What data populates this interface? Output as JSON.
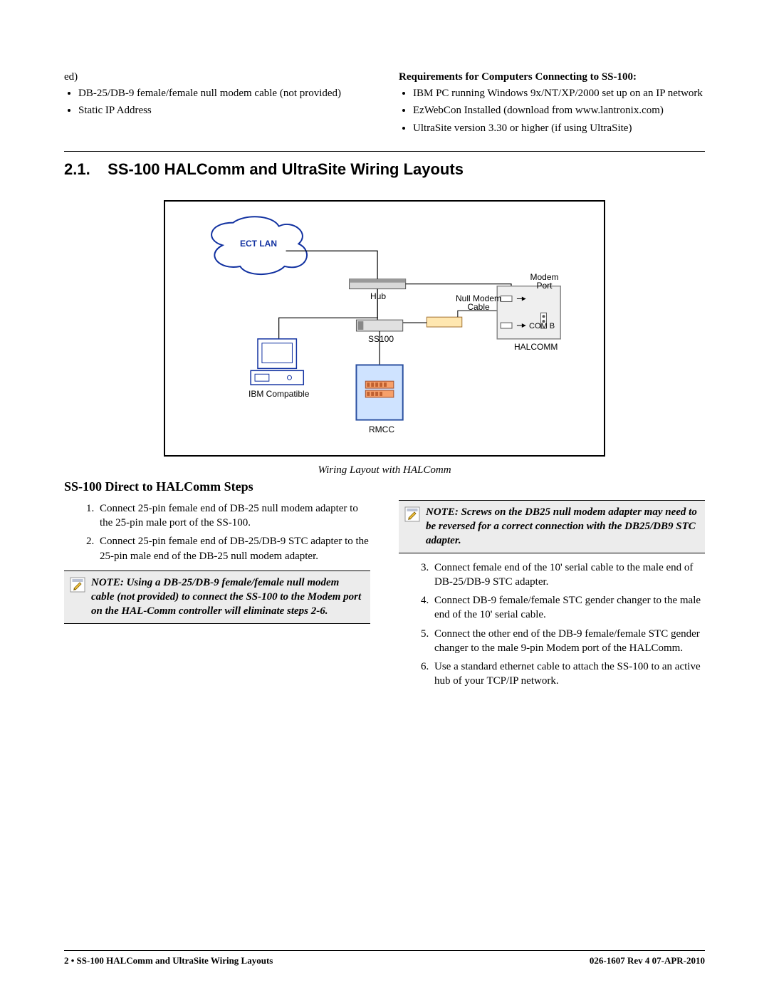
{
  "top": {
    "left_fragment": "ed)",
    "left_bullets": [
      "DB-25/DB-9 female/female null modem cable (not provided)",
      "Static IP Address"
    ],
    "right_heading": "Requirements for Computers Connecting to SS-100:",
    "right_bullets": [
      "IBM PC running Windows 9x/NT/XP/2000 set up on an IP network",
      " EzWebCon Installed (download from www.lantronix.com)",
      "UltraSite version 3.30 or higher (if using UltraSite)"
    ]
  },
  "section": {
    "number": "2.1.",
    "title": "SS-100 HALComm and UltraSite Wiring Layouts"
  },
  "figure": {
    "caption": "Wiring Layout with HALComm",
    "labels": {
      "ectlan": "ECT LAN",
      "hub": "Hub",
      "modem_port": "Modem Port",
      "null_modem": "Null Modem Cable",
      "ss100": "SS100",
      "comb": "COM B",
      "halcomm": "HALCOMM",
      "ibm": "IBM Compatible",
      "rmcc": "RMCC"
    }
  },
  "subsection": {
    "title": "SS-100 Direct to HALComm Steps"
  },
  "steps_left": [
    "Connect 25-pin female end of DB-25 null modem adapter to the 25-pin male port of the SS-100.",
    "Connect 25-pin female end of DB-25/DB-9 STC adapter to the 25-pin male end of the DB-25 null modem adapter."
  ],
  "note_left": "NOTE: Using a DB-25/DB-9 female/female null modem cable (not provided) to connect the SS-100 to the Modem port on the HAL-Comm controller will eliminate steps 2-6.",
  "note_right": "NOTE: Screws on the DB25 null modem adapter may need to be reversed for a correct connection with the DB25/DB9 STC adapter.",
  "steps_right": [
    "Connect female end of the 10' serial cable to the male end of DB-25/DB-9 STC adapter.",
    "Connect DB-9 female/female STC gender changer to the male end of the 10' serial cable.",
    "Connect the other end of the DB-9 female/female STC gender changer to the male 9-pin Modem port of the HALComm.",
    "Use a standard ethernet cable to attach the SS-100 to an active hub of your TCP/IP network."
  ],
  "footer": {
    "left": "2 • SS-100 HALComm and UltraSite Wiring Layouts",
    "right": "026-1607 Rev 4 07-APR-2010"
  }
}
